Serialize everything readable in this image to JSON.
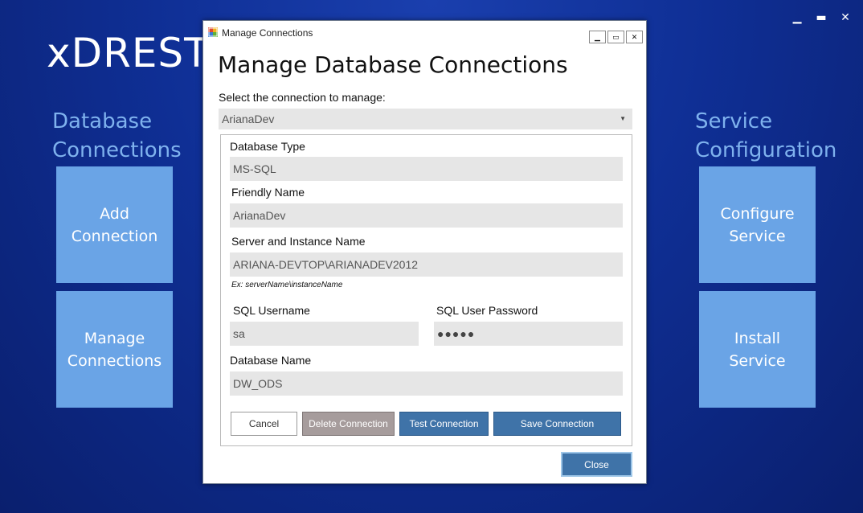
{
  "app": {
    "title": "xDREST",
    "window_controls": {
      "minimize": "▁",
      "maximize": "▬",
      "close": "✕"
    }
  },
  "sections": {
    "database_connections": "Database\nConnections",
    "service_configuration": "Service\nConfiguration"
  },
  "tiles": {
    "add_connection": "Add\nConnection",
    "manage_connections": "Manage\nConnections",
    "configure_service": "Configure\nService",
    "install_service": "Install\nService"
  },
  "dialog": {
    "window_title": "Manage Connections",
    "heading": "Manage Database Connections",
    "select_label": "Select the connection to manage:",
    "selected_connection": "ArianaDev",
    "fields": {
      "database_type_label": "Database Type",
      "database_type_value": "MS-SQL",
      "friendly_name_label": "Friendly Name",
      "friendly_name_value": "ArianaDev",
      "server_label": "Server and Instance Name",
      "server_value": "ARIANA-DEVTOP\\ARIANADEV2012",
      "server_hint": "Ex: serverName\\instanceName",
      "username_label": "SQL Username",
      "username_value": "sa",
      "password_label": "SQL User Password",
      "password_value": "●●●●●",
      "database_name_label": "Database Name",
      "database_name_value": "DW_ODS"
    },
    "buttons": {
      "cancel": "Cancel",
      "delete": "Delete Connection",
      "test": "Test Connection",
      "save": "Save Connection",
      "close": "Close"
    },
    "title_buttons": {
      "minimize": "▁",
      "maximize": "▭",
      "close": "✕"
    }
  },
  "colors": {
    "tile": "#6aa4e6",
    "section_heading": "#7fb2ee",
    "primary_button": "#3f73a8",
    "delete_button": "#a69c9c"
  }
}
